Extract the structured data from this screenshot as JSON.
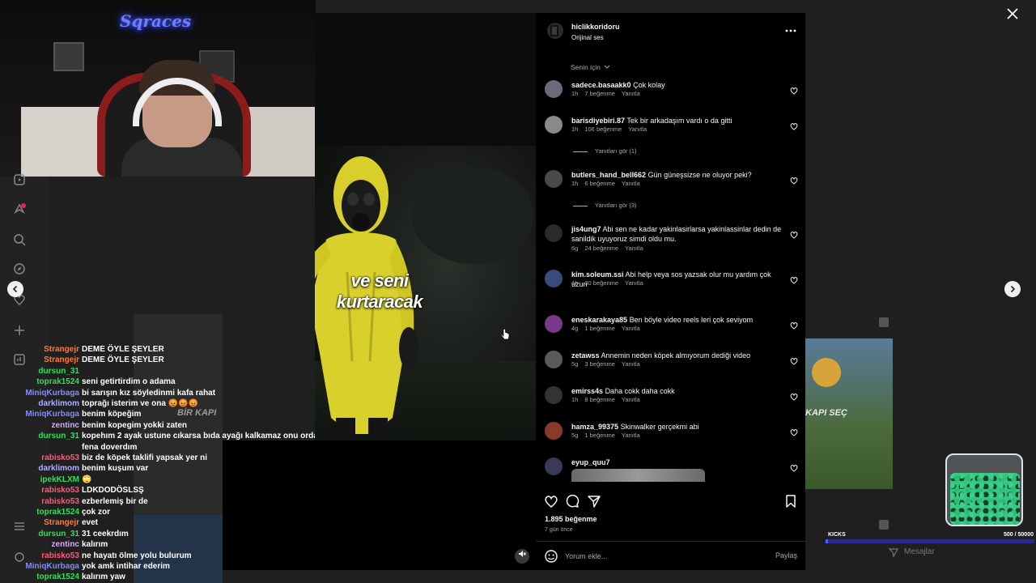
{
  "stream": {
    "logo_text": "Sqraces",
    "chat": [
      {
        "user": "Strangejr",
        "color": "#ff7a2f",
        "msg": "DEME ÖYLE ŞEYLER"
      },
      {
        "user": "Strangejr",
        "color": "#ff7a2f",
        "msg": "DEME ÖYLE ŞEYLER"
      },
      {
        "user": "dursun_31",
        "color": "#2ee05a",
        "msg": ""
      },
      {
        "user": "toprak1524",
        "color": "#2ee05a",
        "msg": "seni getirtirdim o adama"
      },
      {
        "user": "MiniqKurbaga",
        "color": "#7f8cff",
        "msg": "bi sarışın kız söyledinmi kafa rahat"
      },
      {
        "user": "darklimom",
        "color": "#b0b0ff",
        "msg": "toprağı isterim ve ona 😡😡😡"
      },
      {
        "user": "MiniqKurbaga",
        "color": "#7f8cff",
        "msg": "benim köpeğim"
      },
      {
        "user": "zentinc",
        "color": "#d8a8ff",
        "msg": "benim kopegim yokki zaten"
      },
      {
        "user": "dursun_31",
        "color": "#2ee05a",
        "msg": "kopehım 2 ayak ustune cıkarsa bıda ayağı kalkamaz onu orda"
      },
      {
        "user": "",
        "color": "#ffffff",
        "msg": "fena doverdım"
      },
      {
        "user": "rabisko53",
        "color": "#ff5a7a",
        "msg": "biz de köpek taklifi yapsak yer ni"
      },
      {
        "user": "darklimom",
        "color": "#b0b0ff",
        "msg": "benim kuşum var"
      },
      {
        "user": "ipekKLXM",
        "color": "#2ee05a",
        "msg": "🙄"
      },
      {
        "user": "rabisko53",
        "color": "#ff5a7a",
        "msg": "LDKDODÖSLSŞ"
      },
      {
        "user": "rabisko53",
        "color": "#ff5a7a",
        "msg": "ezberlemiş bir de"
      },
      {
        "user": "toprak1524",
        "color": "#2ee05a",
        "msg": "çok zor"
      },
      {
        "user": "Strangejr",
        "color": "#ff7a2f",
        "msg": "evet"
      },
      {
        "user": "dursun_31",
        "color": "#2ee05a",
        "msg": "31 ceekrdım"
      },
      {
        "user": "zentinc",
        "color": "#d8a8ff",
        "msg": "kalırım"
      },
      {
        "user": "rabisko53",
        "color": "#ff5a7a",
        "msg": "ne hayatı ölme yolu bulurum"
      },
      {
        "user": "MiniqKurbaga",
        "color": "#7f8cff",
        "msg": "yok amk intihar ederim"
      },
      {
        "user": "toprak1524",
        "color": "#2ee05a",
        "msg": "kalırım yaw"
      }
    ],
    "bg_text_left": "BİR KAPI",
    "bg_text_right": "KAPI SEÇ",
    "kicks_label": "KICKS",
    "kicks_goal": "500 / 50000",
    "kicks_progress": 0.01,
    "messages_label": "Mesajlar"
  },
  "video": {
    "subtitle": "ve seni kurtaracak"
  },
  "post": {
    "username": "hiclikkoridoru",
    "audio": "Orijinal ses",
    "sort_label": "Senin için",
    "comments": [
      {
        "user": "sadece.basaakk0",
        "text": "Çok kolay",
        "time": "1h",
        "likes": "7 beğenme",
        "reply": "Yanıtla",
        "avatar": "#6a6a7a"
      },
      {
        "user": "barisdiyebiri.87",
        "text": "Tek bir arkadaşım vardı o da gitti",
        "time": "1h",
        "likes": "106 beğenme",
        "reply": "Yanıtla",
        "avatar": "#8a8a8a",
        "view_replies": "Yanıtları gör (1)"
      },
      {
        "user": "butlers_hand_bell662",
        "text": "Gün güneşsizse ne oluyor peki?",
        "time": "1h",
        "likes": "6 beğenme",
        "reply": "Yanıtla",
        "avatar": "#4a4a4a",
        "view_replies": "Yanıtları gör (3)"
      },
      {
        "user": "jis4ung7",
        "text": "Abi sen ne kadar yakinlasirlarsa yakinlassinlar dedin de sanildik uyuyoruz simdi oldu mu.",
        "time": "6g",
        "likes": "24 beğenme",
        "reply": "Yanıtla",
        "avatar": "#2a2a2a"
      },
      {
        "user": "kim.soleum.ssi",
        "text": "Abi help veya sos yazsak olur mu yardım çok uzun",
        "time": "1h",
        "likes": "30 beğenme",
        "reply": "Yanıtla",
        "avatar": "#3a4a7a"
      },
      {
        "user": "eneskarakaya85",
        "text": "Ben böyle video reels leri çok seviyom",
        "time": "4g",
        "likes": "1 beğenme",
        "reply": "Yanıtla",
        "avatar": "#7a3a8a"
      },
      {
        "user": "zetawss",
        "text": "Annemin neden köpek almıyorum dediği video",
        "time": "5g",
        "likes": "3 beğenme",
        "reply": "Yanıtla",
        "avatar": "#5a5a5a"
      },
      {
        "user": "emirss4s",
        "text": "Daha cokk daha cokk",
        "time": "1h",
        "likes": "8 beğenme",
        "reply": "Yanıtla",
        "avatar": "#333333"
      },
      {
        "user": "hamza_99375",
        "text": "Skinwalker gerçekmi abi",
        "time": "5g",
        "likes": "1 beğenme",
        "reply": "Yanıtla",
        "avatar": "#8a3a2a"
      },
      {
        "user": "eyup_quu7",
        "text": "",
        "time": "",
        "likes": "",
        "reply": "",
        "avatar": "#3a3a5a"
      }
    ],
    "likes_count": "1.895 beğenme",
    "posted_ago": "7 gün önce",
    "comment_placeholder": "Yorum ekle...",
    "share_label": "Paylaş"
  }
}
